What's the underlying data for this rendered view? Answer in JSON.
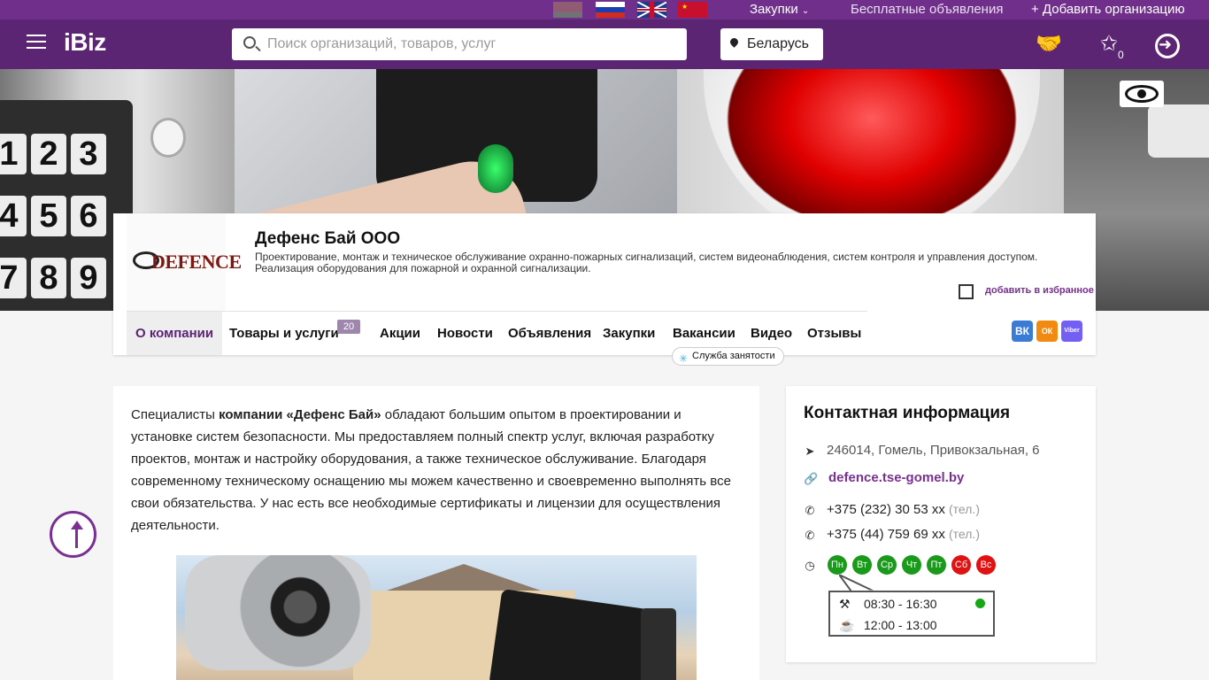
{
  "top": {
    "languages": [
      "by",
      "ru",
      "en",
      "cn"
    ],
    "links": {
      "zakupki": "Закупки",
      "free_ads": "Бесплатные объявления",
      "add_org": "+ Добавить организацию"
    }
  },
  "header": {
    "logo": "iBiz",
    "search_placeholder": "Поиск организаций, товаров, услуг",
    "region": "Беларусь",
    "favorites_count": "0"
  },
  "company": {
    "logo_word": "DEFENCE",
    "name": "Дефенс Бай ООО",
    "description": "Проектирование, монтаж и техническое обслуживание охранно-пожарных сигнализаций, систем видеонаблюдения, систем контроля и управления доступом. Реализация оборудования для пожарной и охранной сигнализации.",
    "favorite_label": "добавить в избранное",
    "tabs": [
      {
        "label": "О компании"
      },
      {
        "label": "Товары и услуги",
        "badge": "20"
      },
      {
        "label": "Акции"
      },
      {
        "label": "Новости"
      },
      {
        "label": "Объявления"
      },
      {
        "label": "Закупки"
      },
      {
        "label": "Вакансии"
      },
      {
        "label": "Видео"
      },
      {
        "label": "Отзывы"
      }
    ],
    "employment_badge": "Служба занятости",
    "social": [
      "ВК",
      "ОК",
      "Viber"
    ]
  },
  "about": {
    "intro": "Специалисты ",
    "company_bold": "компании «Дефенс Бай»",
    "rest": " обладают большим опытом в проектировании и установке систем безопасности. Мы предоставляем полный спектр услуг, включая разработку проектов, монтаж и настройку оборудования, а также техническое обслуживание. Благодаря современному техническому оснащению мы можем качественно и своевременно выполнять все свои обязательства. У нас есть все необходимые сертификаты и лицензии для осуществления деятельности."
  },
  "contact": {
    "title": "Контактная информация",
    "address": "246014, Гомель, Привокзальная, 6",
    "website": "defence.tse-gomel.by",
    "phones": [
      {
        "number": "+375 (232) 30 53 xx",
        "note": "(тел.)"
      },
      {
        "number": "+375 (44) 759 69 xx",
        "note": "(тел.)"
      }
    ],
    "days": [
      {
        "label": "Пн",
        "status": "work"
      },
      {
        "label": "Вт",
        "status": "work"
      },
      {
        "label": "Ср",
        "status": "work"
      },
      {
        "label": "Чт",
        "status": "work"
      },
      {
        "label": "Пт",
        "status": "work"
      },
      {
        "label": "Сб",
        "status": "off"
      },
      {
        "label": "Вс",
        "status": "off"
      }
    ],
    "work_hours": "08:30 - 16:30",
    "lunch_hours": "12:00 - 13:00",
    "colors": {
      "work_day": "#1a9a1a",
      "day_off": "#e01212",
      "open_now": "#16a816"
    }
  },
  "colors": {
    "brand": "#5c2573",
    "accent": "#7a2f92"
  }
}
